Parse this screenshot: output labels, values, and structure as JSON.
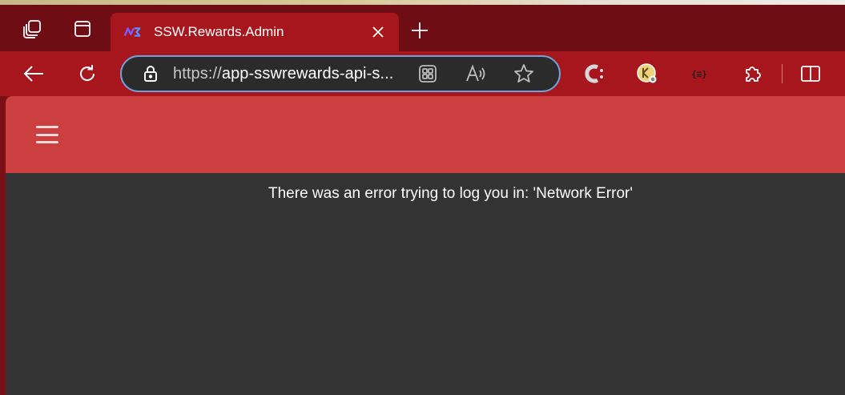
{
  "browser": {
    "tab": {
      "title": "SSW.Rewards.Admin",
      "favicon": "ssw-rewards-logo-icon"
    },
    "address": {
      "protocol": "https://",
      "host": "app-sswrewards-api-s..."
    },
    "icons": {
      "workspaces": "workspaces-icon",
      "tab_actions": "tab-actions-icon",
      "close_tab": "close-icon",
      "new_tab": "plus-icon",
      "back": "back-arrow-icon",
      "refresh": "refresh-icon",
      "lock": "lock-icon",
      "app_available": "app-available-icon",
      "read_aloud": "read-aloud-icon",
      "favorite": "star-icon",
      "ext1": "c-extension-icon",
      "ext2": "keeper-extension-icon",
      "ext3": "json-extension-icon",
      "extensions": "puzzle-icon",
      "split_screen": "split-screen-icon"
    },
    "colors": {
      "tabbar": "#6f0d14",
      "toolbar": "#a8161d",
      "address_border": "#6fa0d8"
    }
  },
  "app": {
    "appbar_color": "#cc3f41",
    "background": "#333333",
    "error_message": "There was an error trying to log you in: 'Network Error'"
  }
}
